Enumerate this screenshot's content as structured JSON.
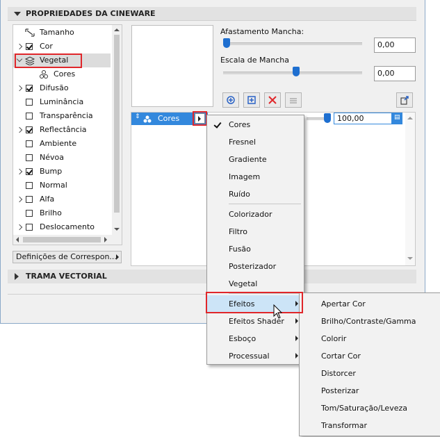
{
  "panel": {
    "title": "PROPRIEDADES DA CINEWARE",
    "section2_title": "TRAMA VECTORIAL",
    "correspondence_button": "Definições de Correspon..."
  },
  "tree": {
    "items": [
      {
        "label": "Tamanho",
        "checkbox": "none",
        "icon": "size-icon",
        "expander": "none"
      },
      {
        "label": "Cor",
        "checkbox": "checked",
        "expander": "collapsed"
      },
      {
        "label": "Vegetal",
        "checkbox": "none",
        "icon": "layers-icon",
        "expander": "expanded",
        "selected": true
      },
      {
        "label": "Cores",
        "checkbox": "none",
        "icon": "colors-icon",
        "expander": "none"
      },
      {
        "label": "Difusão",
        "checkbox": "checked",
        "expander": "collapsed"
      },
      {
        "label": "Luminância",
        "checkbox": "unchecked",
        "expander": "none"
      },
      {
        "label": "Transparência",
        "checkbox": "unchecked",
        "expander": "none"
      },
      {
        "label": "Reflectância",
        "checkbox": "checked",
        "expander": "collapsed"
      },
      {
        "label": "Ambiente",
        "checkbox": "unchecked",
        "expander": "none"
      },
      {
        "label": "Névoa",
        "checkbox": "unchecked",
        "expander": "none"
      },
      {
        "label": "Bump",
        "checkbox": "checked",
        "expander": "collapsed"
      },
      {
        "label": "Normal",
        "checkbox": "unchecked",
        "expander": "none"
      },
      {
        "label": "Alfa",
        "checkbox": "unchecked",
        "expander": "collapsed"
      },
      {
        "label": "Brilho",
        "checkbox": "unchecked",
        "expander": "none"
      },
      {
        "label": "Deslocamento",
        "checkbox": "unchecked",
        "expander": "collapsed"
      }
    ]
  },
  "settings": {
    "spot_distance_label": "Afastamento Mancha:",
    "spot_distance_value": "0,00",
    "spot_distance_fraction": 0.0,
    "spot_scale_label": "Escala de Mancha",
    "spot_scale_value": "0,00",
    "spot_scale_fraction": 0.5
  },
  "toolbar": {
    "icons": [
      "add-shader-icon",
      "add-layer-icon",
      "delete-icon",
      "layers-disabled-icon",
      "export-icon"
    ]
  },
  "channel": {
    "row_label": "Cores",
    "opacity_value": "100,00"
  },
  "context_menu": {
    "items": [
      {
        "label": "Cores",
        "checked": true
      },
      {
        "label": "Fresnel"
      },
      {
        "label": "Gradiente"
      },
      {
        "label": "Imagem"
      },
      {
        "label": "Ruído"
      },
      {
        "label": "Colorizador"
      },
      {
        "label": "Filtro"
      },
      {
        "label": "Fusão"
      },
      {
        "label": "Posterizador"
      },
      {
        "label": "Vegetal"
      },
      {
        "label": "Efeitos",
        "submenu": true,
        "highlighted": true
      },
      {
        "label": "Efeitos Shader",
        "submenu": true
      },
      {
        "label": "Esboço",
        "submenu": true
      },
      {
        "label": "Processual",
        "submenu": true
      }
    ]
  },
  "submenu": {
    "items": [
      "Apertar Cor",
      "Brilho/Contraste/Gamma",
      "Colorir",
      "Cortar Cor",
      "Distorcer",
      "Posterizar",
      "Tom/Saturação/Leveza",
      "Transformar"
    ]
  },
  "colors": {
    "highlight_red": "#e0262a",
    "selection_blue": "#3388dd",
    "menu_highlight": "#cce4f7",
    "slider_blue": "#1e6fd0"
  }
}
